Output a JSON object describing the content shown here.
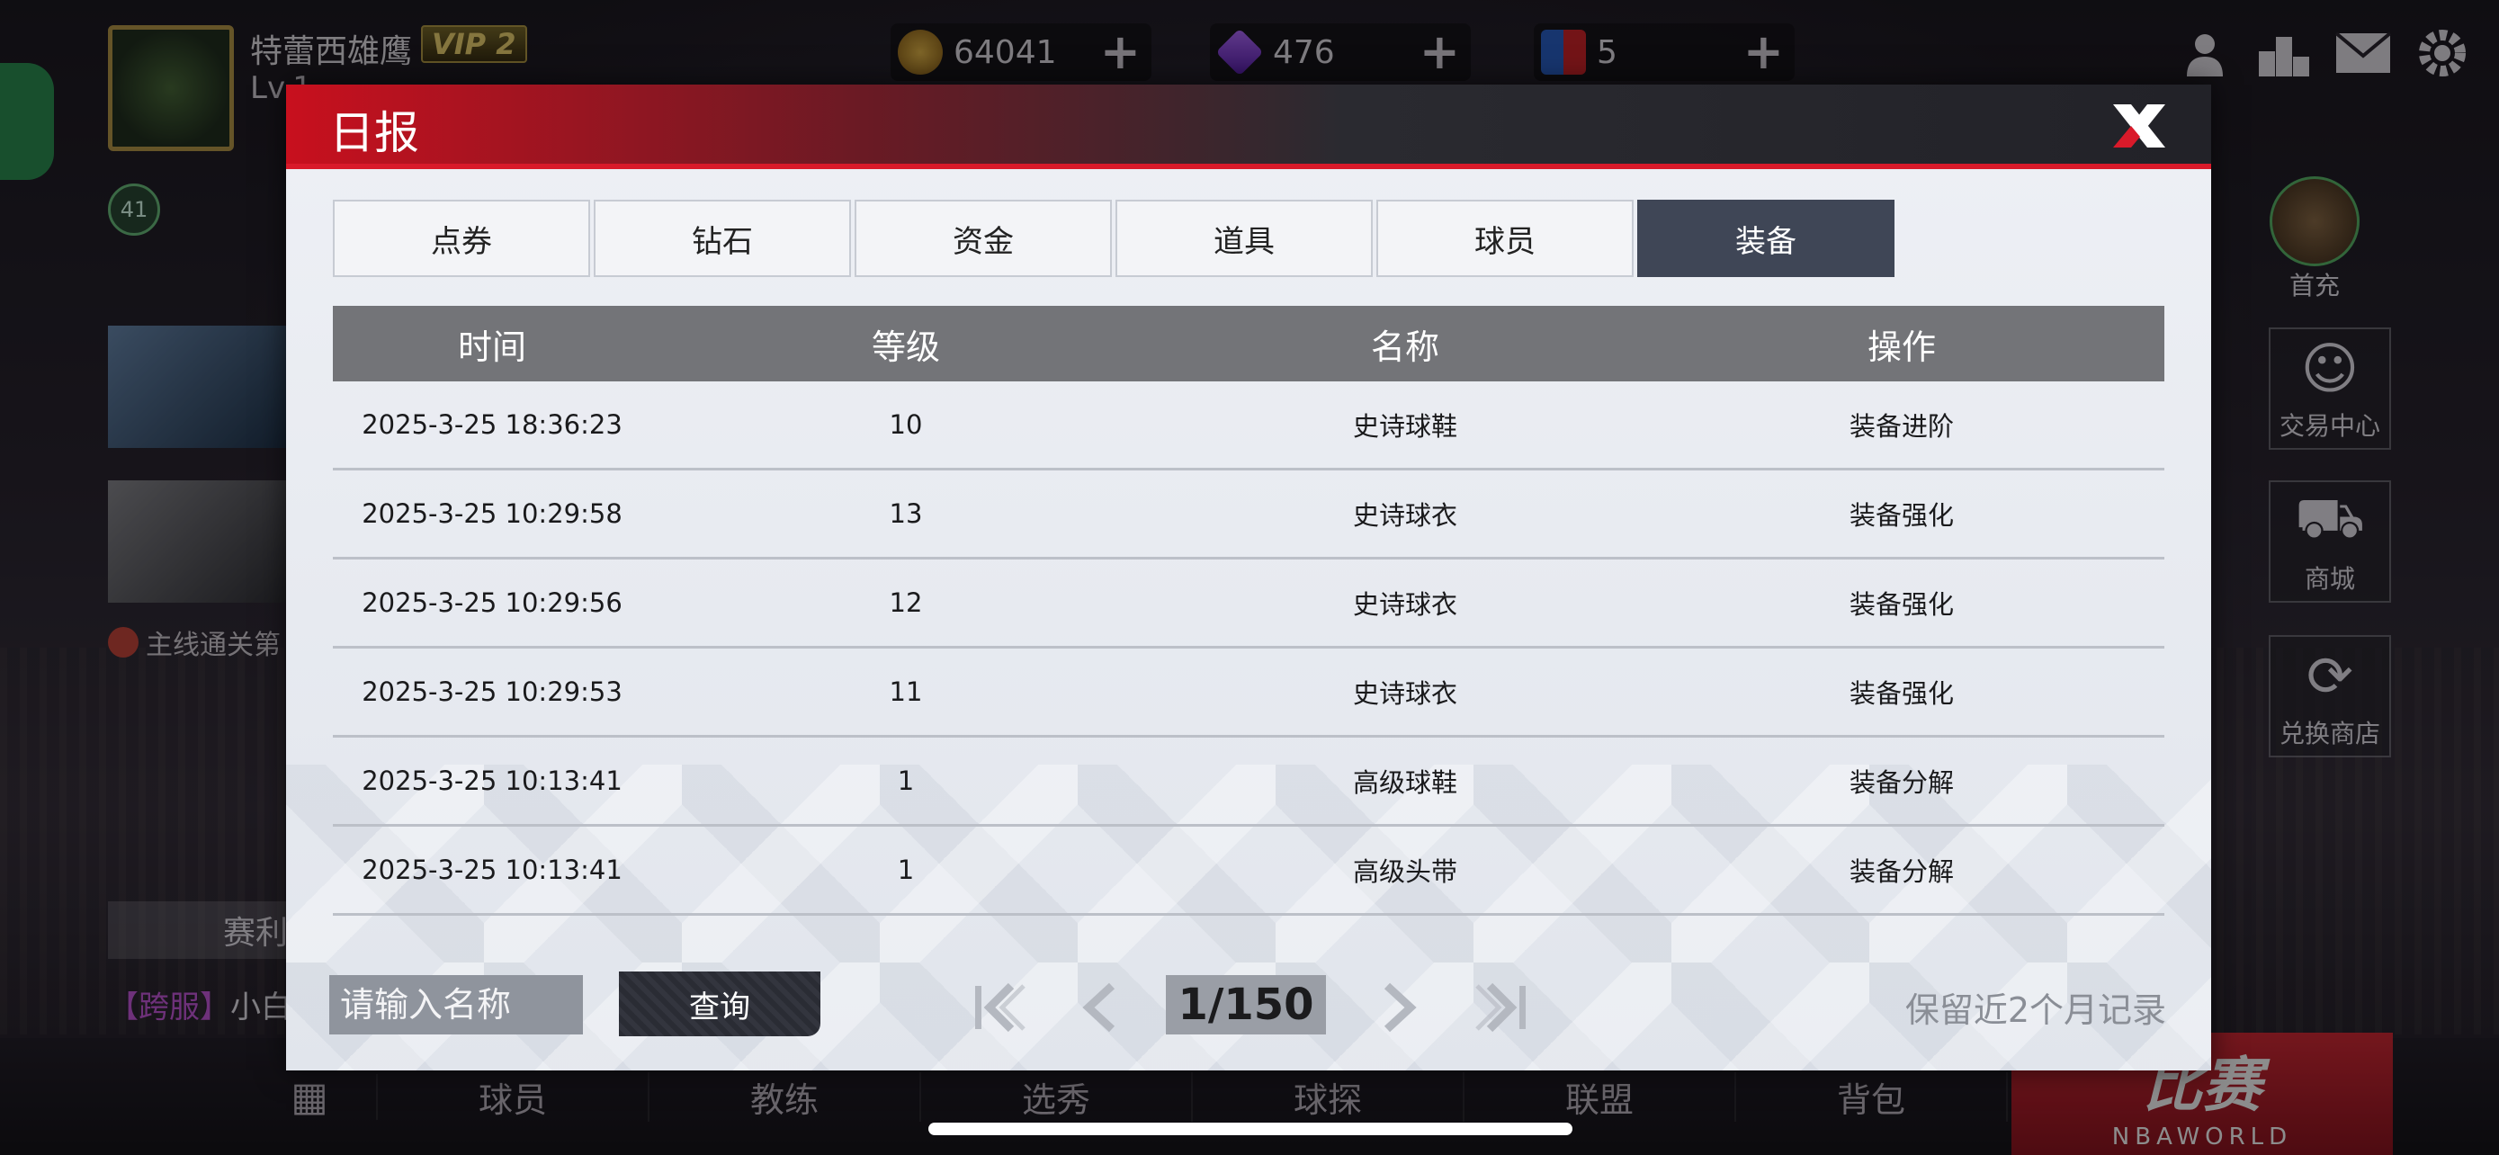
{
  "background": {
    "player_name": "特蕾西雄鹰",
    "vip_label": "VIP 2",
    "level_text": "Lv.1",
    "badge_text": "41",
    "currencies": [
      {
        "name": "gold-coin-icon",
        "value": "64041"
      },
      {
        "name": "diamond-icon",
        "value": "476"
      },
      {
        "name": "ticket-icon",
        "value": "5"
      }
    ],
    "first_recharge_label": "首充",
    "right_buttons": [
      {
        "label": "交易中心",
        "icon": "trade-center-icon"
      },
      {
        "label": "商城",
        "icon": "shop-cart-icon"
      },
      {
        "label": "兑换商店",
        "icon": "exchange-shop-icon"
      }
    ],
    "main_quest_text": "主线通关第",
    "season_text": "赛利",
    "cross_server_tag": "【跨服】",
    "cross_server_text": "小白",
    "bottom_nav": [
      "球员",
      "教练",
      "选秀",
      "球探",
      "联盟",
      "背包"
    ],
    "match_button_title": "比赛",
    "match_button_sub": "NBAWORLD"
  },
  "dialog": {
    "title": "日报",
    "tabs": [
      {
        "label": "点券",
        "active": false
      },
      {
        "label": "钻石",
        "active": false
      },
      {
        "label": "资金",
        "active": false
      },
      {
        "label": "道具",
        "active": false
      },
      {
        "label": "球员",
        "active": false
      },
      {
        "label": "装备",
        "active": true
      }
    ],
    "columns": [
      "时间",
      "等级",
      "名称",
      "操作"
    ],
    "rows": [
      {
        "time": "2025-3-25 18:36:23",
        "level": "10",
        "name": "史诗球鞋",
        "action": "装备进阶"
      },
      {
        "time": "2025-3-25 10:29:58",
        "level": "13",
        "name": "史诗球衣",
        "action": "装备强化"
      },
      {
        "time": "2025-3-25 10:29:56",
        "level": "12",
        "name": "史诗球衣",
        "action": "装备强化"
      },
      {
        "time": "2025-3-25 10:29:53",
        "level": "11",
        "name": "史诗球衣",
        "action": "装备强化"
      },
      {
        "time": "2025-3-25 10:13:41",
        "level": "1",
        "name": "高级球鞋",
        "action": "装备分解"
      },
      {
        "time": "2025-3-25 10:13:41",
        "level": "1",
        "name": "高级头带",
        "action": "装备分解"
      }
    ],
    "search_placeholder": "请输入名称",
    "query_label": "查询",
    "page_display": "1/150",
    "retention_note": "保留近2个月记录"
  }
}
